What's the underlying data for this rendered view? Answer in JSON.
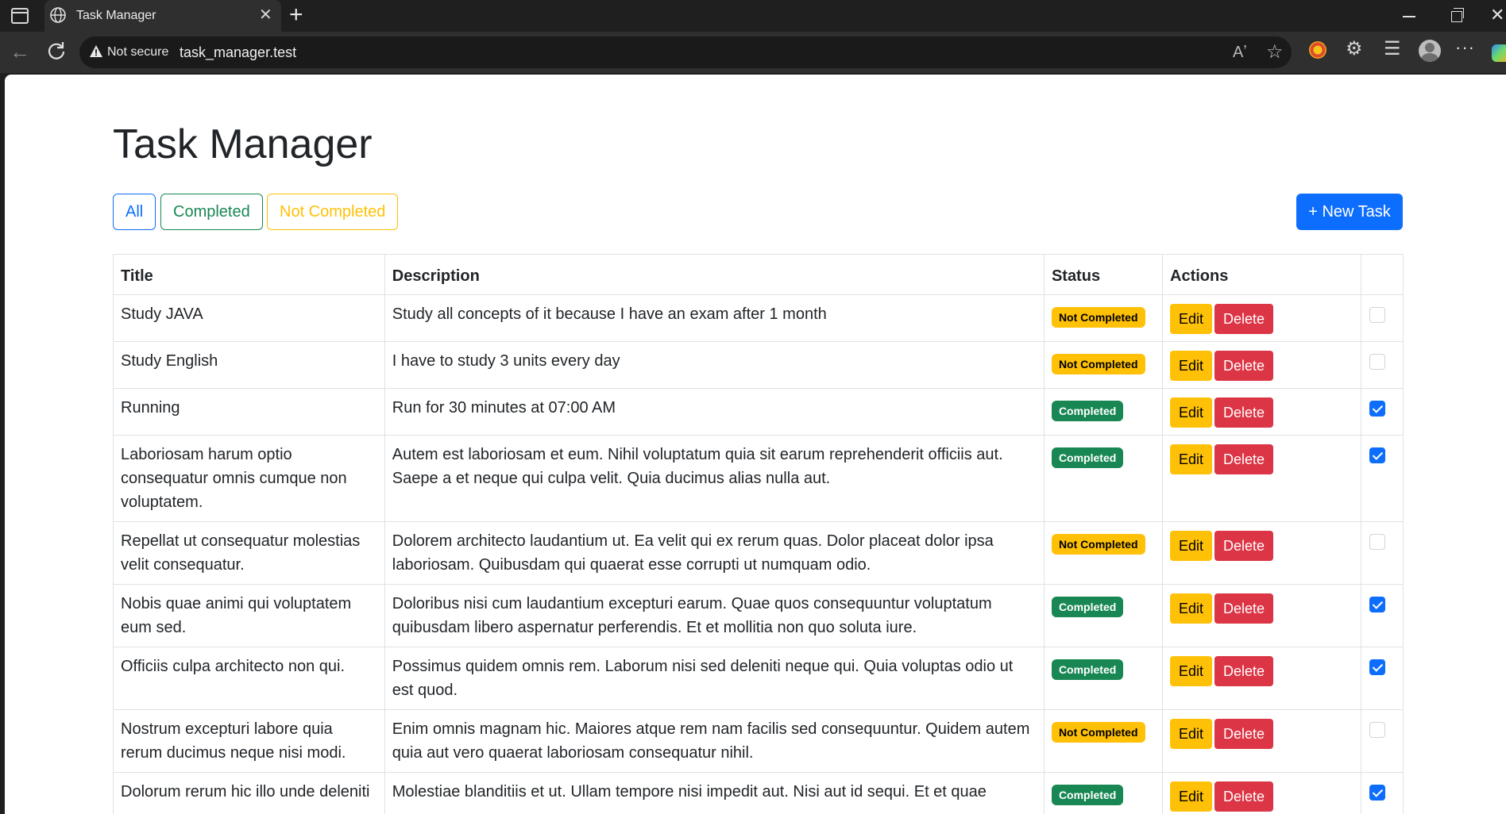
{
  "browser": {
    "tab_title": "Task Manager",
    "security_label": "Not secure",
    "url": "task_manager.test"
  },
  "page": {
    "title": "Task Manager",
    "filters": {
      "all": "All",
      "completed": "Completed",
      "not_completed": "Not Completed"
    },
    "new_task_label": "+ New Task"
  },
  "table": {
    "headers": {
      "title": "Title",
      "description": "Description",
      "status": "Status",
      "actions": "Actions"
    },
    "edit_label": "Edit",
    "delete_label": "Delete",
    "rows": [
      {
        "title": "Study JAVA",
        "description": "Study all concepts of it because I have an exam after 1 month",
        "status": "Not Completed",
        "done": false
      },
      {
        "title": "Study English",
        "description": "I have to study 3 units every day",
        "status": "Not Completed",
        "done": false
      },
      {
        "title": "Running",
        "description": "Run for 30 minutes at 07:00 AM",
        "status": "Completed",
        "done": true
      },
      {
        "title": "Laboriosam harum optio consequatur omnis cumque non voluptatem.",
        "description": "Autem est laboriosam et eum. Nihil voluptatum quia sit earum reprehenderit officiis aut. Saepe a et neque qui culpa velit. Quia ducimus alias nulla aut.",
        "status": "Completed",
        "done": true
      },
      {
        "title": "Repellat ut consequatur molestias velit consequatur.",
        "description": "Dolorem architecto laudantium ut. Ea velit qui ex rerum quas. Dolor placeat dolor ipsa laboriosam. Quibusdam qui quaerat esse corrupti ut numquam odio.",
        "status": "Not Completed",
        "done": false
      },
      {
        "title": "Nobis quae animi qui voluptatem eum sed.",
        "description": "Doloribus nisi cum laudantium excepturi earum. Quae quos consequuntur voluptatum quibusdam libero aspernatur perferendis. Et et mollitia non quo soluta iure.",
        "status": "Completed",
        "done": true
      },
      {
        "title": "Officiis culpa architecto non qui.",
        "description": "Possimus quidem omnis rem. Laborum nisi sed deleniti neque qui. Quia voluptas odio ut est quod.",
        "status": "Completed",
        "done": true
      },
      {
        "title": "Nostrum excepturi labore quia rerum ducimus neque nisi modi.",
        "description": "Enim omnis magnam hic. Maiores atque rem nam facilis sed consequuntur. Quidem autem quia aut vero quaerat laboriosam consequatur nihil.",
        "status": "Not Completed",
        "done": false
      },
      {
        "title": "Dolorum rerum hic illo unde deleniti",
        "description": "Molestiae blanditiis et ut. Ullam tempore nisi impedit aut. Nisi aut id sequi. Et et quae",
        "status": "Completed",
        "done": true
      }
    ]
  },
  "colors": {
    "primary": "#0d6efd",
    "success": "#198754",
    "warning": "#ffc107",
    "danger": "#dc3545"
  }
}
